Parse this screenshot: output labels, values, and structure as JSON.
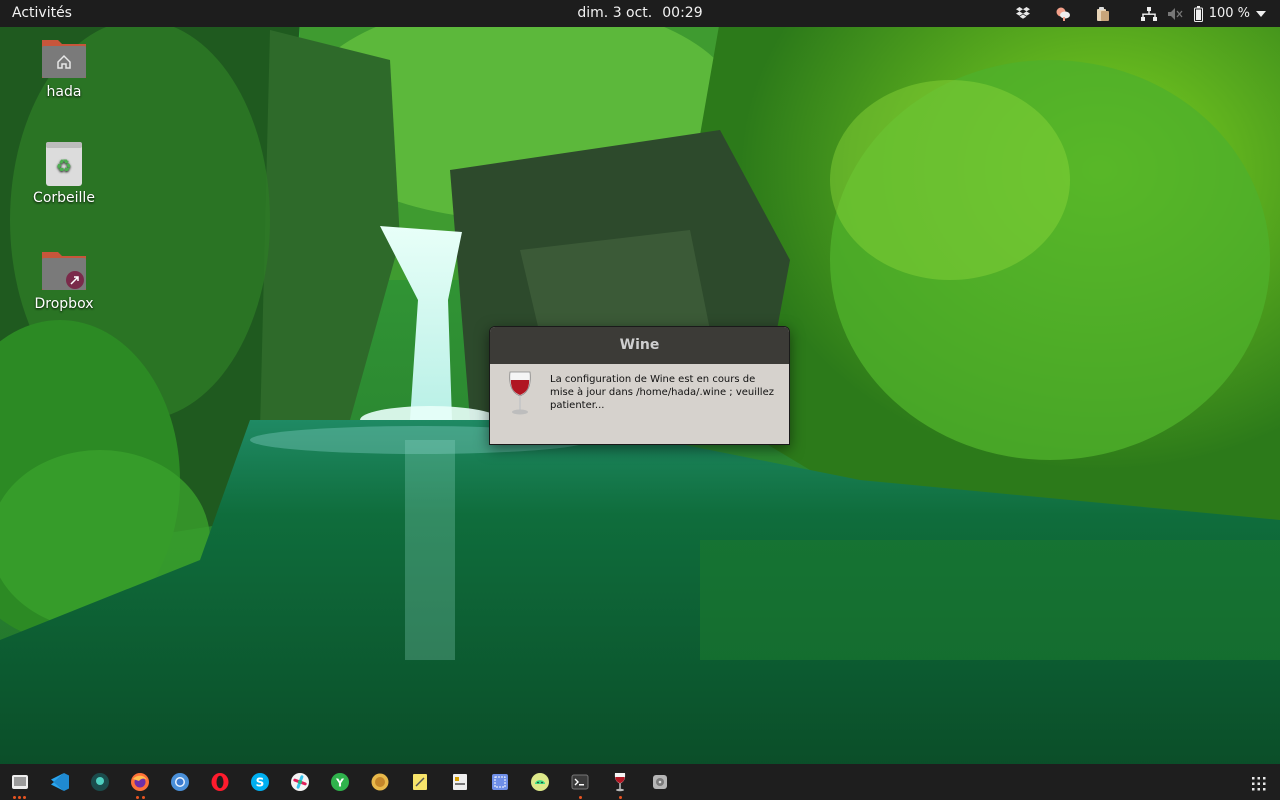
{
  "topbar": {
    "activities": "Activités",
    "date": "dim. 3 oct.",
    "time": "00:29",
    "battery_percent": "100 %",
    "tray_icons": [
      "dropbox-icon",
      "weather-icon",
      "clipboard-icon",
      "network-icon",
      "volume-muted-icon",
      "battery-icon",
      "chevron-down-icon"
    ]
  },
  "desktop": {
    "icons": [
      {
        "label": "hada",
        "icon": "home-folder-icon"
      },
      {
        "label": "Corbeille",
        "icon": "trash-icon"
      },
      {
        "label": "Dropbox",
        "icon": "dropbox-folder-icon"
      }
    ]
  },
  "dialog": {
    "title": "Wine",
    "message": "La configuration de Wine est en cours de mise à jour dans /home/hada/.wine ; veuillez patienter...",
    "icon": "wine-glass-icon"
  },
  "dock": {
    "items": [
      {
        "name": "files",
        "icon": "files-icon",
        "running": true,
        "dots": 3
      },
      {
        "name": "vscode",
        "icon": "vscode-icon",
        "running": false
      },
      {
        "name": "gitkraken",
        "icon": "gitkraken-icon",
        "running": false
      },
      {
        "name": "firefox",
        "icon": "firefox-icon",
        "running": true,
        "dots": 2
      },
      {
        "name": "chromium",
        "icon": "chromium-icon",
        "running": false
      },
      {
        "name": "opera",
        "icon": "opera-icon",
        "running": false
      },
      {
        "name": "skype",
        "icon": "skype-icon",
        "running": false
      },
      {
        "name": "slack",
        "icon": "slack-icon",
        "running": false
      },
      {
        "name": "yandex",
        "icon": "yandex-icon",
        "running": false
      },
      {
        "name": "amule",
        "icon": "amule-icon",
        "running": false
      },
      {
        "name": "notes",
        "icon": "notes-icon",
        "running": false
      },
      {
        "name": "wine-config",
        "icon": "wine-config-icon",
        "running": false
      },
      {
        "name": "screenshot",
        "icon": "screenshot-icon",
        "running": false
      },
      {
        "name": "android-studio",
        "icon": "android-icon",
        "running": false
      },
      {
        "name": "terminal",
        "icon": "terminal-icon",
        "running": true,
        "dots": 1
      },
      {
        "name": "wine",
        "icon": "wine-icon",
        "running": true,
        "dots": 1
      },
      {
        "name": "disk",
        "icon": "disk-icon",
        "running": false
      }
    ],
    "apps_grid_icon": "show-apps-grid-icon"
  },
  "colors": {
    "topbar_bg": "#1d1d1d",
    "dialog_title_bg": "#3c3b37",
    "dialog_body_bg": "#d6d2cd",
    "dock_bg": "#1e1e1e",
    "running_dot": "#e95420"
  }
}
